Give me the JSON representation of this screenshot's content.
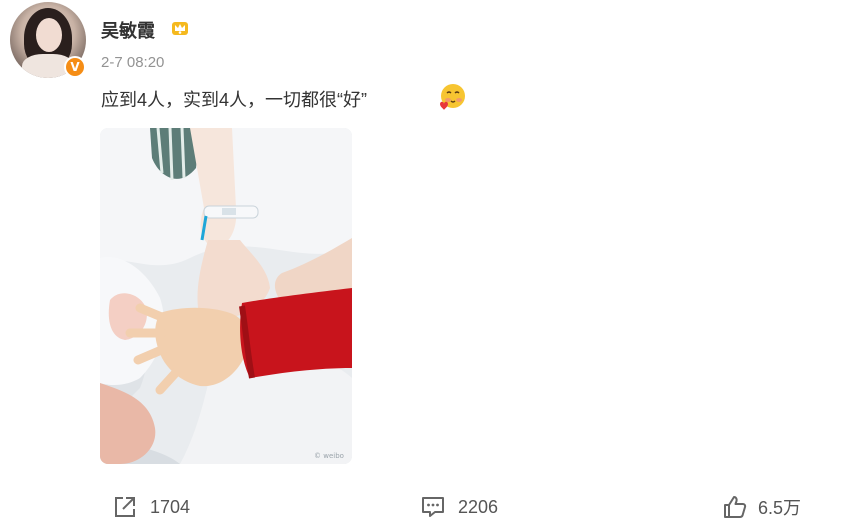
{
  "user": {
    "name": "吴敏霞",
    "verified_badge": "V",
    "badge_icon": "crown-icon",
    "timestamp": "2-7 08:20"
  },
  "post": {
    "text": "应到4人，实到4人，一切都很“好”",
    "emoji": "blush-heart-emoji",
    "photo_icon": "photo-hands"
  },
  "actions": {
    "repost_count": "1704",
    "comment_count": "2206",
    "like_count": "6.5万"
  },
  "colors": {
    "accent_orange": "#f58d16",
    "crown_gold": "#f5b91e",
    "muted_text": "#939393",
    "sleeve_red": "#c8141c"
  }
}
